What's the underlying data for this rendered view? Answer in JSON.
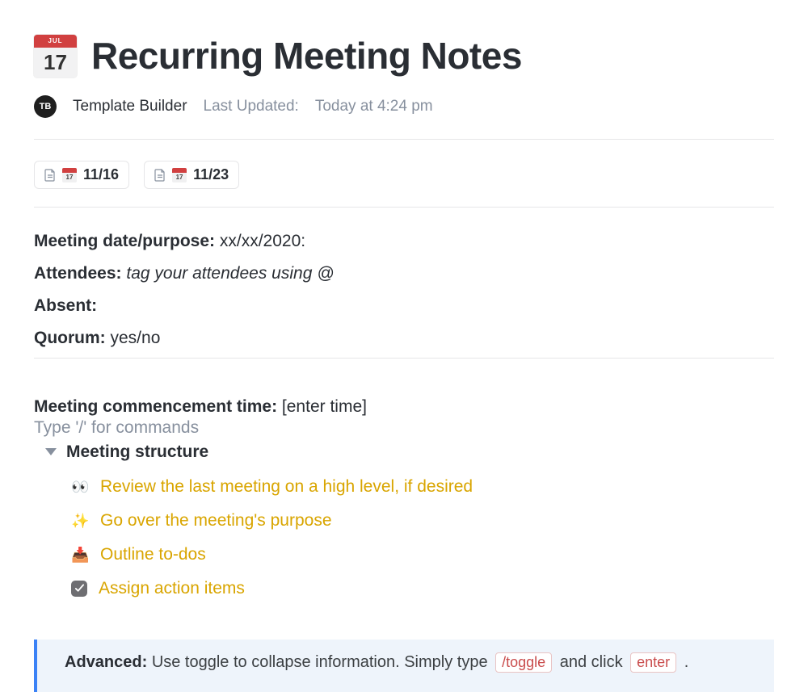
{
  "header": {
    "icon_label_top": "JUL",
    "icon_label_num": "17",
    "title": "Recurring Meeting Notes",
    "avatar_initials": "TB",
    "author": "Template Builder",
    "last_updated_label": "Last Updated:",
    "last_updated_value": "Today at 4:24 pm"
  },
  "links": [
    {
      "mini_num": "17",
      "label": "11/16"
    },
    {
      "mini_num": "17",
      "label": "11/23"
    }
  ],
  "fields": {
    "date_label": "Meeting date/purpose:",
    "date_value": "xx/xx/2020:",
    "attendees_label": "Attendees:",
    "attendees_value": "tag your attendees using @",
    "absent_label": "Absent:",
    "absent_value": "",
    "quorum_label": "Quorum:",
    "quorum_value": "yes/no"
  },
  "commence": {
    "label": "Meeting commencement time:",
    "hint": "[enter time]",
    "slash_hint": "Type '/' for commands"
  },
  "structure": {
    "title": "Meeting structure",
    "items": [
      {
        "emoji": "👀",
        "text": "Review the last meeting on a high level, if desired"
      },
      {
        "emoji": "✨",
        "text": "Go over the meeting's purpose"
      },
      {
        "emoji": "📥",
        "text": "Outline to-dos"
      },
      {
        "emoji": "check",
        "text": "Assign action items"
      }
    ]
  },
  "callout": {
    "strong": "Advanced:",
    "text_before": "Use toggle to collapse information. Simply type",
    "pill1": "/toggle",
    "text_mid": "and click",
    "pill2": "enter",
    "text_after": "."
  }
}
